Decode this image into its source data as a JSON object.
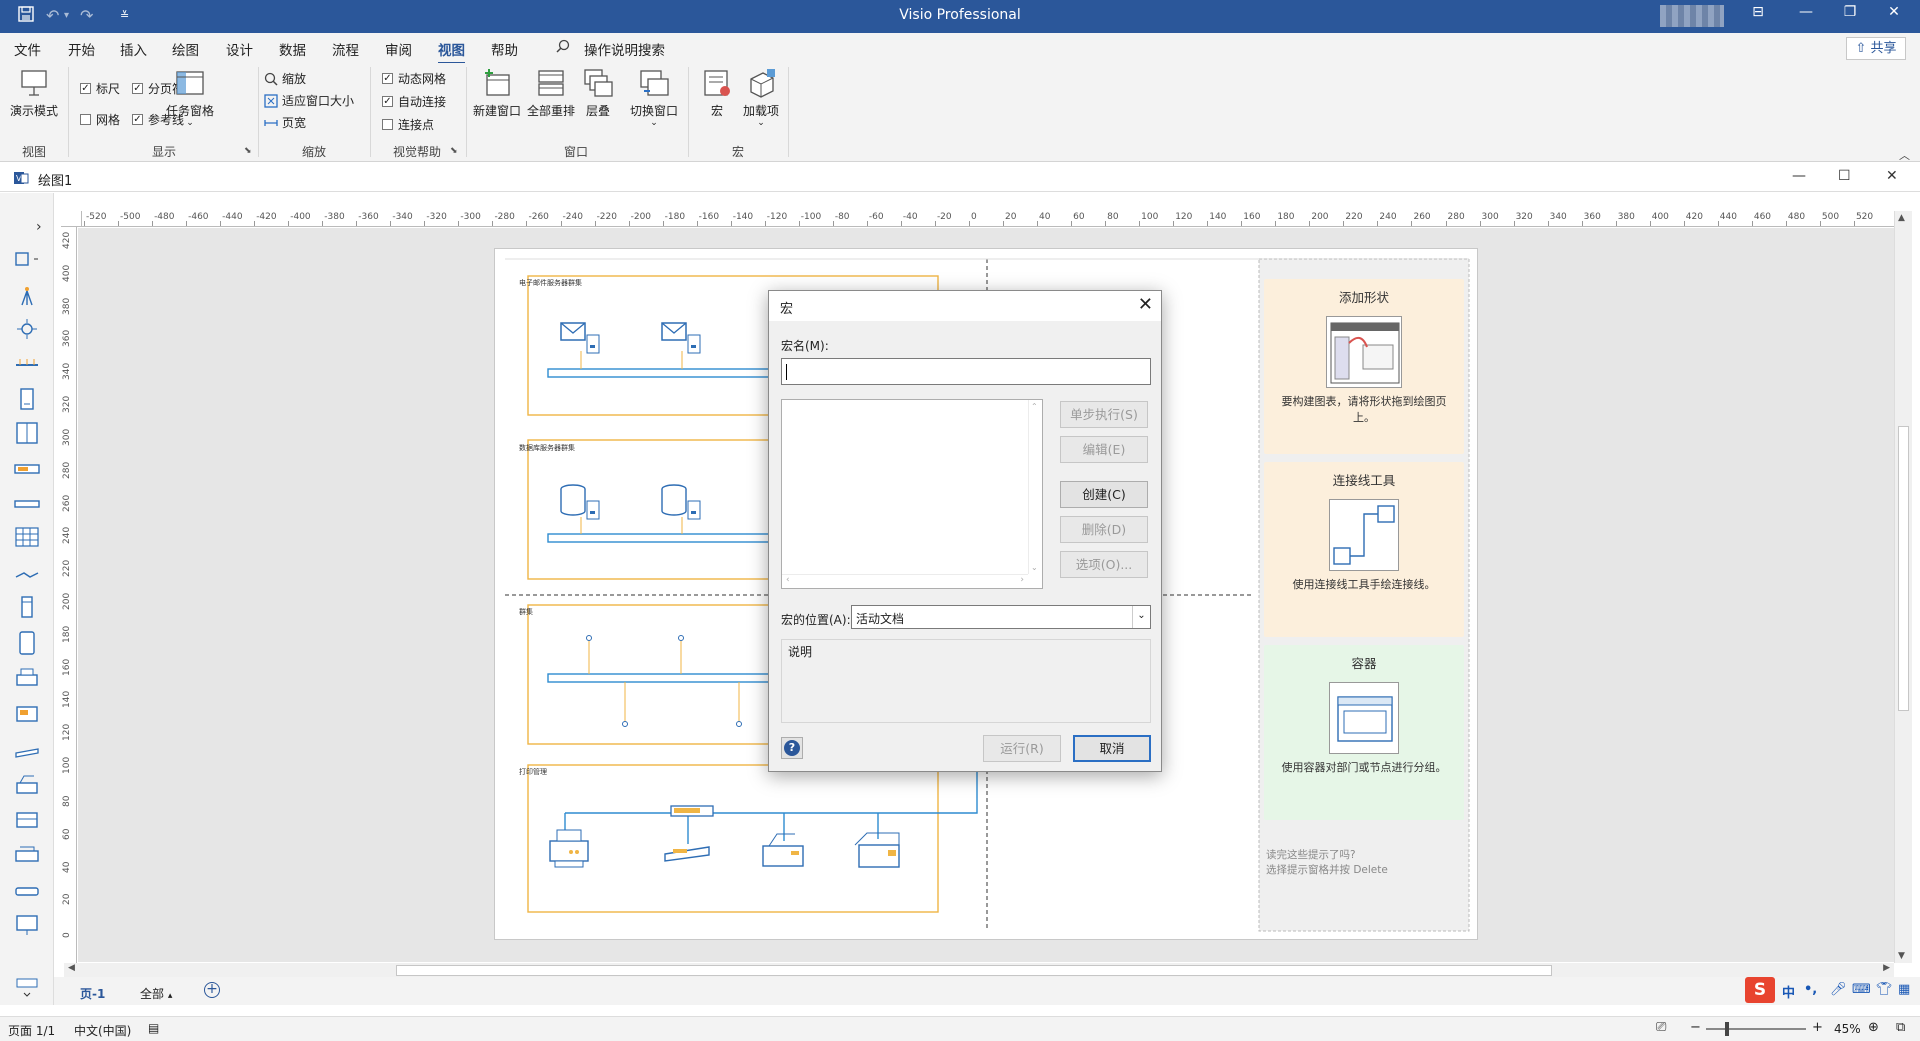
{
  "app": {
    "title": "Visio Professional",
    "quick_access": [
      "save-icon",
      "undo-icon",
      "redo-icon",
      "customize-icon"
    ]
  },
  "tabs": [
    "文件",
    "开始",
    "插入",
    "绘图",
    "设计",
    "数据",
    "流程",
    "审阅",
    "视图",
    "帮助"
  ],
  "active_tab": "视图",
  "search": {
    "label": "操作说明搜索"
  },
  "share": {
    "label": "共享"
  },
  "ribbon": {
    "groups": {
      "view": "视图",
      "show": "显示",
      "zoom": "缩放",
      "visual_aids": "视觉帮助",
      "window": "窗口",
      "macros": "宏"
    },
    "presentation_mode": "演示模式",
    "show_checks": [
      {
        "label": "标尺",
        "checked": true
      },
      {
        "label": "分页符",
        "checked": true
      },
      {
        "label": "网格",
        "checked": false
      },
      {
        "label": "参考线",
        "checked": true
      }
    ],
    "task_panes": "任务窗格",
    "zoom_items": [
      "缩放",
      "适应窗口大小",
      "页宽"
    ],
    "aid_checks": [
      {
        "label": "动态网格",
        "checked": true
      },
      {
        "label": "自动连接",
        "checked": true
      },
      {
        "label": "连接点",
        "checked": false
      }
    ],
    "window_buttons": [
      "新建窗口",
      "全部重排",
      "层叠",
      "切换窗口"
    ],
    "macro_buttons": [
      "宏",
      "加载项"
    ]
  },
  "document": {
    "title": "绘图1"
  },
  "ruler": {
    "h_ticks": [
      "-520",
      "-500",
      "-480",
      "-460",
      "-440",
      "-420",
      "-400",
      "-380",
      "-360",
      "-340",
      "-320",
      "-300",
      "-280",
      "-260",
      "-240",
      "-220",
      "-200",
      "-180",
      "-160",
      "-140",
      "-120",
      "-100",
      "-80",
      "-60",
      "-40",
      "-20",
      "0",
      "20",
      "40",
      "60",
      "80",
      "100",
      "120",
      "140",
      "160",
      "180",
      "200",
      "220",
      "240",
      "260",
      "280",
      "300",
      "320",
      "340",
      "360",
      "380",
      "400",
      "420",
      "440",
      "460",
      "480",
      "500",
      "520"
    ],
    "v_ticks": [
      "420",
      "400",
      "380",
      "360",
      "340",
      "320",
      "300",
      "280",
      "260",
      "240",
      "220",
      "200",
      "180",
      "160",
      "140",
      "120",
      "100",
      "80",
      "60",
      "40",
      "20",
      "0"
    ]
  },
  "diagram": {
    "containers": [
      "电子邮件服务器群集",
      "数据库服务器群集",
      "群集",
      "打印管理"
    ]
  },
  "tips": [
    {
      "title": "添加形状",
      "desc": "要构建图表，请将形状拖到绘图页上。"
    },
    {
      "title": "连接线工具",
      "desc": "使用连接线工具手绘连接线。"
    },
    {
      "title": "容器",
      "desc": "使用容器对部门或节点进行分组。"
    }
  ],
  "tips_footer": [
    "读完这些提示了吗?",
    "选择提示窗格并按 Delete"
  ],
  "dialog": {
    "title": "宏",
    "name_label": "宏名(M):",
    "name_value": "",
    "buttons": {
      "step": "单步执行(S)",
      "edit": "编辑(E)",
      "create": "创建(C)",
      "delete": "删除(D)",
      "options": "选项(O)...",
      "run": "运行(R)",
      "cancel": "取消"
    },
    "location_label": "宏的位置(A):",
    "location_value": "活动文档",
    "description_label": "说明"
  },
  "page_tabs": {
    "current": "页-1",
    "all": "全部"
  },
  "status": {
    "page": "页面 1/1",
    "language": "中文(中国)",
    "zoom": "45%"
  },
  "ime": {
    "labels": [
      "中",
      "•,"
    ]
  },
  "colors": {
    "title_bar": "#2b579a",
    "container_border": "#f0b545",
    "network_line": "#2e8bd0",
    "tip_orange": "#fcefdc",
    "tip_green": "#e6f6e7"
  }
}
